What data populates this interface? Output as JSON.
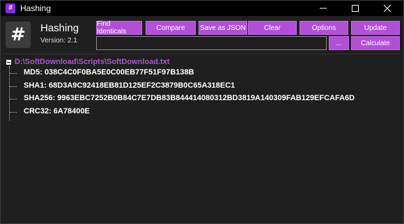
{
  "window": {
    "title": "Hashing",
    "icon": "hash-icon"
  },
  "header": {
    "app_name": "Hashing",
    "version": "Version: 2.1",
    "logo_glyph": "#"
  },
  "toolbar": {
    "find_identicals": "Find Identicals",
    "compare": "Compare",
    "save_json": "Save as JSON",
    "clear": "Clear",
    "options": "Options",
    "update": "Update",
    "browse": "...",
    "calculate": "Calculate"
  },
  "path_input": {
    "value": "",
    "placeholder": ""
  },
  "tree": {
    "root": "D:\\SoftDownload\\Scripts\\SoftDownload.txt",
    "items": [
      {
        "label": "MD5: 038C4C0F0BA5E0C00EB77F51F97B138B"
      },
      {
        "label": "SHA1: 68D3A9C92418EB81D125EF2C3879B0C65A318EC1"
      },
      {
        "label": "SHA256: 9963EBC7252B0B84C7E7DB83B844414080312BD3819A140309FAB129EFCAFA6D"
      },
      {
        "label": "CRC32: 6A78400E"
      }
    ]
  },
  "colors": {
    "accent": "#b24fd8",
    "background": "#1f1f1f",
    "titlebar": "#000000"
  }
}
